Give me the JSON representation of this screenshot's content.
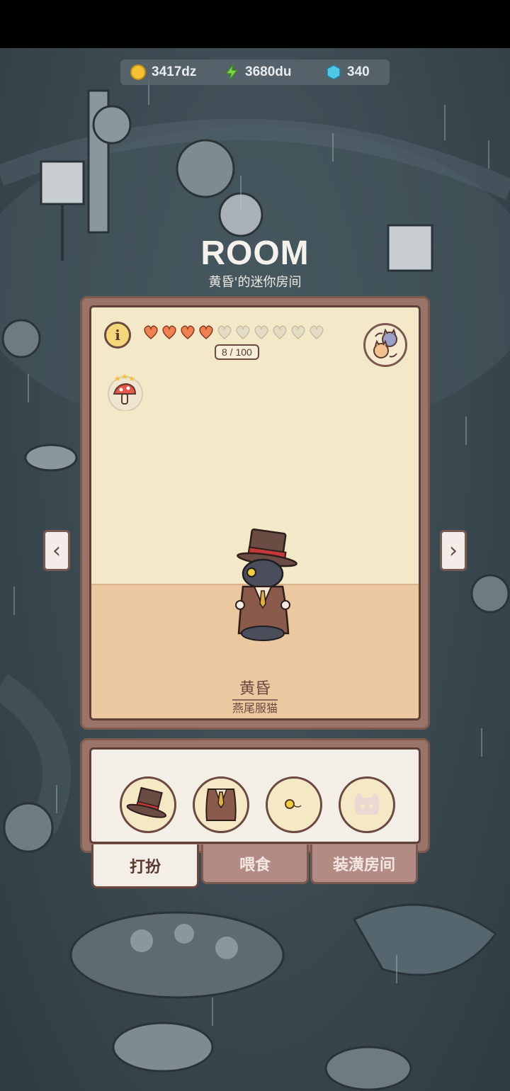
{
  "currency": {
    "coins": "3417dz",
    "energy": "3680du",
    "gems": "340"
  },
  "room": {
    "title": "ROOM",
    "subtitle": "黄昏'的迷你房间"
  },
  "affection": {
    "count_label": "8 / 100",
    "hearts_filled": 4,
    "hearts_total": 10
  },
  "cat": {
    "name": "黄昏",
    "outfit": "燕尾服猫"
  },
  "navigation": {
    "prev": "‹",
    "next": "›"
  },
  "tabs": {
    "dress_up": "打扮",
    "feed": "喂食",
    "decorate": "装潢房间"
  },
  "info_symbol": "i",
  "icons": {
    "coin": "coin-icon",
    "energy": "lightning-icon",
    "gem": "gem-icon",
    "slots": [
      "top-hat-icon",
      "tailcoat-icon",
      "monocle-icon",
      "locked-slot-icon"
    ]
  },
  "colors": {
    "heart_filled": "#f0804e",
    "heart_empty": "#e4dcc4",
    "card_frame": "#9a7468",
    "floor": "#ecc8a0",
    "wall": "#f3e8c8"
  }
}
